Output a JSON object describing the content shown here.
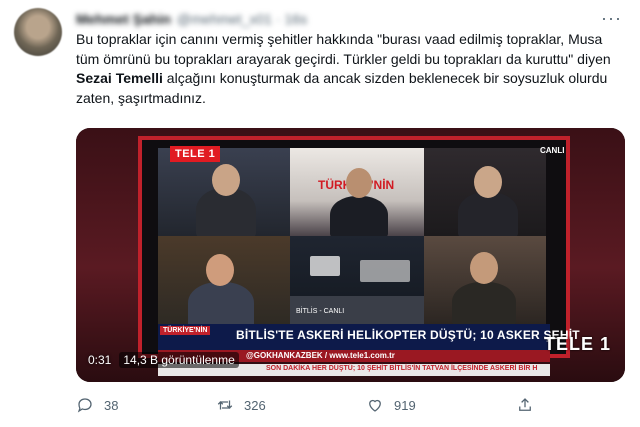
{
  "tweet": {
    "author_name": "Mehmet Şahin",
    "author_handle": "@mehmet_x01 · 16s",
    "text_before": "Bu topraklar için canını vermiş şehitler hakkında \"burası vaad edilmiş topraklar, Musa tüm ömrünü bu toprakları arayarak geçirdi. Türkler geldi bu toprakları da kuruttu\" diyen ",
    "text_bold": "Sezai Temelli",
    "text_after": " alçağını konuşturmak da ancak sizden beklenecek bir soysuzluk olurdu zaten, şaşırtmadınız."
  },
  "video": {
    "channel_logo": "TELE 1",
    "live_label": "CANLI",
    "studio_banner": "TÜRKİYE'NİN",
    "location_tag": "BİTLİS - CANLI",
    "show_tag": "TÜRKİYE'NİN",
    "headline": "BİTLİS'TE ASKERİ HELİKOPTER DÜŞTÜ; 10 ASKER ŞEHİT",
    "subline": "@GOKHANKAZBEK / www.tele1.com.tr",
    "ticker": "SON DAKİKA   HER DÜŞTÜ; 10 ŞEHİT   BİTLİS'İN TATVAN İLÇESİNDE ASKERİ BİR H",
    "watermark": "TELE 1",
    "time": "0:31",
    "views": "14,3 B görüntülenme"
  },
  "actions": {
    "replies": "38",
    "retweets": "326",
    "likes": "919"
  },
  "icons": {
    "more": "more-icon",
    "reply": "reply-icon",
    "retweet": "retweet-icon",
    "like": "heart-icon",
    "share": "share-icon"
  },
  "colors": {
    "text": "#0f1419",
    "muted": "#536471",
    "tele1_red": "#e11b22",
    "lower_third": "#0d1a4a"
  }
}
